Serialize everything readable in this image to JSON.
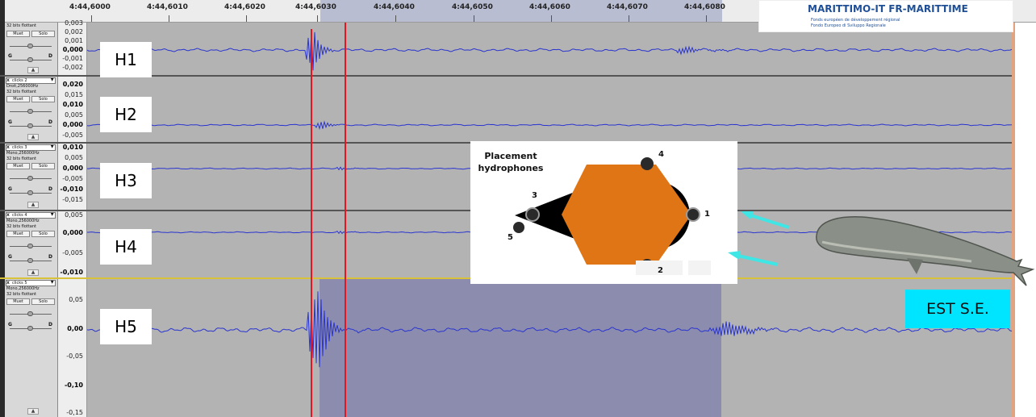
{
  "colors": {
    "waveform": "#2a35d0",
    "selection": "#8c8dae",
    "marker": "#e8141f",
    "track_bg": "#b3b3b3",
    "label_bg": "#00e5ff",
    "hexagon": "#e07515",
    "arrow": "#3ee6e6"
  },
  "ruler": {
    "ticks": [
      "4:44,6000",
      "4:44,6010",
      "4:44,6020",
      "4:44,6030",
      "4:44,6040",
      "4:44,6050",
      "4:44,6060",
      "4:44,6070",
      "4:44,6080"
    ]
  },
  "logo": {
    "title": "MARITTIMO-IT FR-MARITTIME",
    "line1": "Fonds européen de développement régional",
    "line2": "Fondo Europeo di Sviluppo Regionale"
  },
  "tracks": [
    {
      "label": "H1",
      "info_lines": [
        "32 bits flottant"
      ],
      "scale": [
        "0,003",
        "0,002",
        "0,001",
        "0,000",
        "-0,001",
        "-0,002"
      ]
    },
    {
      "label": "H2",
      "name": "clicks 2",
      "info_lines": [
        "Droit,256000Hz",
        "32 bits flottant"
      ],
      "scale": [
        "0,020",
        "0,015",
        "0,010",
        "0,005",
        "0,000",
        "-0,005"
      ]
    },
    {
      "label": "H3",
      "name": "clicks 3",
      "info_lines": [
        "Mono,256000Hz",
        "32 bits flottant"
      ],
      "scale": [
        "0,010",
        "0,005",
        "0,000",
        "-0,005",
        "-0,010",
        "-0,015"
      ]
    },
    {
      "label": "H4",
      "name": "clicks 4",
      "info_lines": [
        "Mono,256000Hz",
        "32 bits flottant"
      ],
      "scale": [
        "0,005",
        "0,000",
        "-0,005",
        "-0,010"
      ]
    },
    {
      "label": "H5",
      "name": "clicks 5",
      "info_lines": [
        "Mono,256000Hz",
        "32 bits flottant"
      ],
      "scale": [
        "0,05",
        "0,00",
        "-0,05",
        "-0,10",
        "-0,15"
      ]
    }
  ],
  "controls": {
    "mute": "Muet",
    "solo": "Solo",
    "gain_left": "G",
    "gain_right": "D"
  },
  "diagram": {
    "title_line1": "Placement",
    "title_line2": "hydrophones",
    "hydrophones": [
      "1",
      "2",
      "3",
      "4",
      "5"
    ]
  },
  "direction_label": "EST S.E."
}
